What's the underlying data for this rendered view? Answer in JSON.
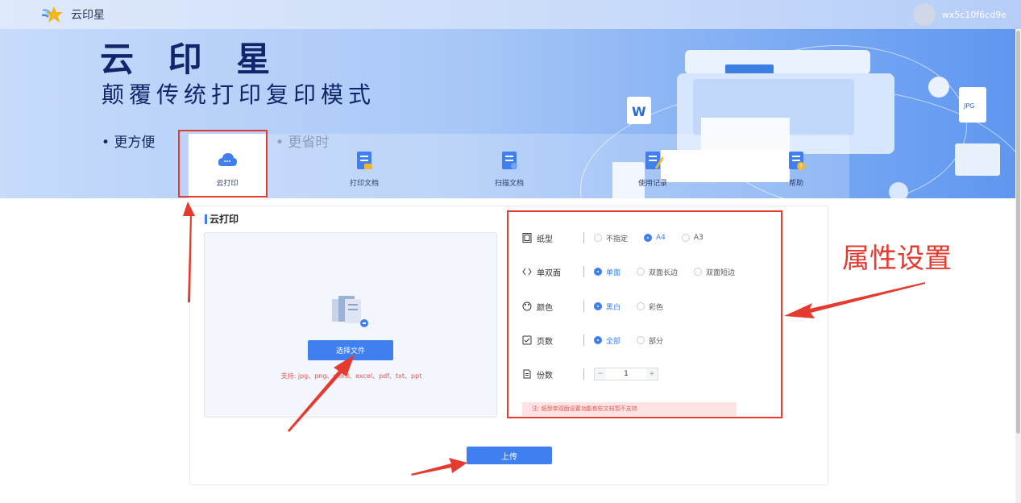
{
  "header": {
    "logo_text": "云印星",
    "username": "wx5c10f6cd9e"
  },
  "hero": {
    "title": "云 印 星",
    "subtitle": "颠覆传统打印复印模式",
    "bullets": [
      "• 更方便",
      "• 更省时"
    ]
  },
  "nav": {
    "items": [
      {
        "label": "云打印",
        "icon": "cloud-print-icon"
      },
      {
        "label": "打印文档",
        "icon": "document-icon"
      },
      {
        "label": "扫描文档",
        "icon": "scan-document-icon"
      },
      {
        "label": "使用记录",
        "icon": "history-icon"
      },
      {
        "label": "帮助",
        "icon": "help-icon"
      }
    ]
  },
  "panel": {
    "title": "云打印",
    "choose_button": "选择文件",
    "support_text": "支持: jpg、png、word、excel、pdf、txt、ppt",
    "upload_button": "上传",
    "note": "注: 纸型单双面设置功能有些文档暂不支持"
  },
  "properties": {
    "paper": {
      "label": "纸型",
      "options": [
        "不指定",
        "A4",
        "A3"
      ],
      "selected": "A4"
    },
    "sides": {
      "label": "单双面",
      "options": [
        "单面",
        "双面长边",
        "双面短边"
      ],
      "selected": "单面"
    },
    "color": {
      "label": "颜色",
      "options": [
        "黑白",
        "彩色"
      ],
      "selected": "黑白"
    },
    "pages": {
      "label": "页数",
      "options": [
        "全部",
        "部分"
      ],
      "selected": "全部"
    },
    "copies": {
      "label": "份数",
      "value": "1",
      "minus": "−",
      "plus": "+"
    }
  },
  "annotation": {
    "text": "属性设置",
    "color": "#e53a2f"
  },
  "colors": {
    "accent": "#3f7ff0",
    "annotation_red": "#e53a2f",
    "hero_text": "#10256a"
  }
}
